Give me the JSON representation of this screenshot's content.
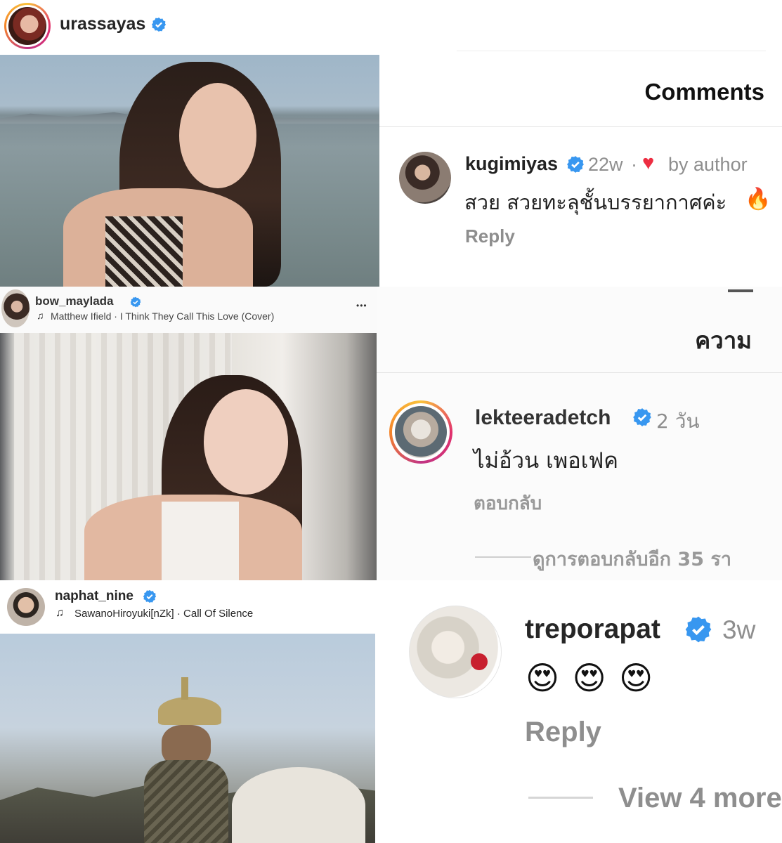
{
  "post1": {
    "username": "urassayas",
    "comments_title": "Comments",
    "comment": {
      "username": "kugimiyas",
      "time": "22w",
      "separator": "·",
      "liked_label": "by author",
      "text": "สวย สวยทะลุชั้นบรรยากาศค่ะ",
      "emoji": "🔥",
      "reply_label": "Reply"
    }
  },
  "post2": {
    "username": "bow_maylada",
    "music": "Matthew Ifield · I Think They Call This Love (Cover)",
    "more": "•••",
    "comments_title": "ความ",
    "comment": {
      "username": "lekteeradetch",
      "time": "2 วัน",
      "text": "ไม่อ้วน เพอเฟค",
      "reply_label": "ตอบกลับ",
      "view_replies": "ดูการตอบกลับอีก 35 รา"
    }
  },
  "post3": {
    "username": "naphat_nine",
    "music": "SawanoHiroyuki[nZk] · Call Of Silence",
    "comment": {
      "username": "treporapat",
      "time": "3w",
      "emojis": "😍 😍 😍",
      "reply_label": "Reply",
      "view_more": "View 4 more"
    }
  },
  "colors": {
    "verified": "#3897f0",
    "meta_gray": "#8e8e8e",
    "heart": "#ed2d41"
  }
}
